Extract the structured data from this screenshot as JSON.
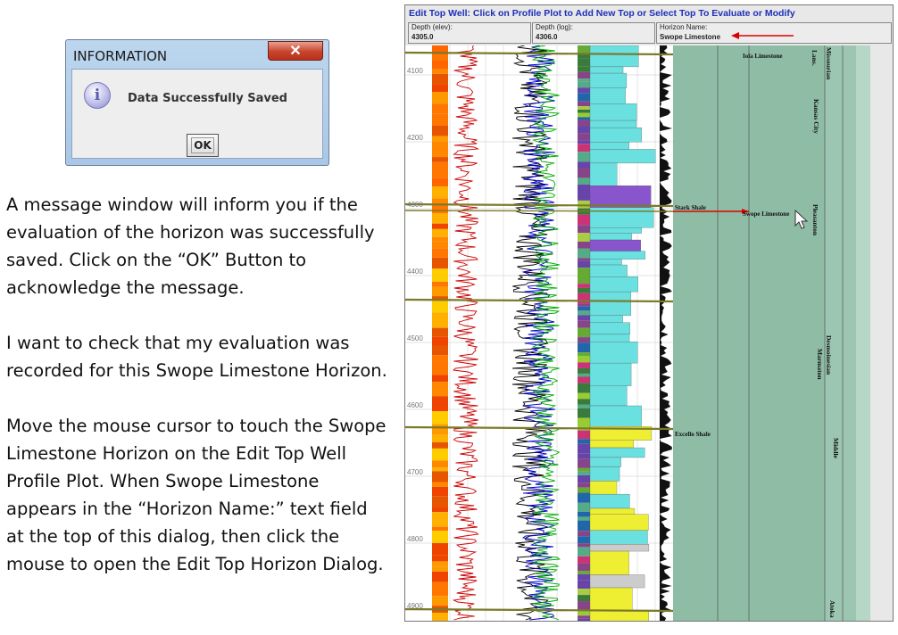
{
  "dialog": {
    "title": "INFORMATION",
    "close_glyph": "✕",
    "message": "Data Successfully Saved",
    "ok_label": "OK",
    "icon": "info-icon"
  },
  "instructions": {
    "p1": "A message window will inform you if the evaluation of the horizon was successfully saved.  Click on the “OK” Button to acknowledge the message.",
    "p2": "I want to check that my evaluation was recorded for this Swope Limestone Horizon.",
    "p3": "Move the mouse cursor to touch the Swope Limestone Horizon on the Edit Top Well Profile Plot.  When Swope Limestone appears in the “Horizon Name:” text field at the top of this dialog, then click the mouse to open the Edit Top Horizon Dialog."
  },
  "panel": {
    "title": "Edit Top Well: Click on Profile Plot to Add New Top or Select Top To Evaluate or Modify",
    "depth_elev_label": "Depth (elev):",
    "depth_elev_value": "4305.0",
    "depth_log_label": "Depth (log):",
    "depth_log_value": "4306.0",
    "horizon_label": "Horizon Name:",
    "horizon_value": "Swope Limestone"
  },
  "plot": {
    "depth_ticks": [
      "4100",
      "4200",
      "4300",
      "4400",
      "4500",
      "4600",
      "4700",
      "4800",
      "4900"
    ],
    "horizons": [
      {
        "name": "Iola Limestone"
      },
      {
        "name": "Stark Shale"
      },
      {
        "name": "Swope Limestone"
      },
      {
        "name": "Excello Shale"
      }
    ],
    "age_labels": [
      "Missourian",
      "Lans.",
      "Kansas City",
      "Pleasanton",
      "Desmoinesian",
      "Marmaton",
      "Middle",
      "Atoka"
    ],
    "accent_color": "#dd0000",
    "fill_color": "#8fbca5"
  }
}
